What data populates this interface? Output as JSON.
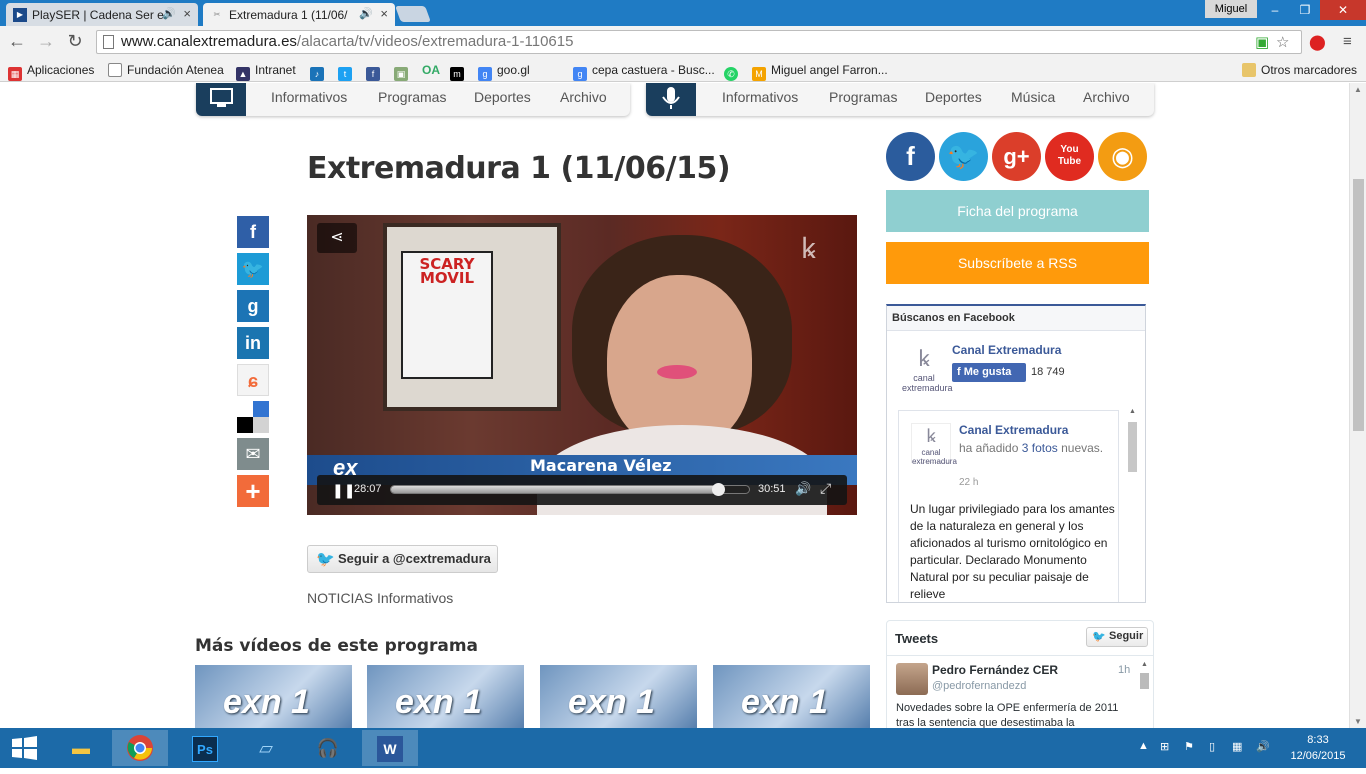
{
  "browser": {
    "tabs": [
      {
        "title": "PlaySER | Cadena Ser e",
        "favicon": "playser-icon"
      },
      {
        "title": "Extremadura 1 (11/06/",
        "favicon": "canal-extremadura-icon"
      }
    ],
    "user_name": "Miguel",
    "url_host": "www.canalextremadura.es",
    "url_path": "/alacarta/tv/videos/extremadura-1-110615",
    "bookmarks": [
      {
        "label": "Aplicaciones",
        "icon": "apps-grid-icon",
        "color": "#d33"
      },
      {
        "label": "Fundación Atenea",
        "icon": "page-icon",
        "color": "#ffffff"
      },
      {
        "label": "Intranet",
        "icon": "intranet-icon",
        "color": "#336"
      },
      {
        "label": "",
        "icon": "ser-icon",
        "color": "#1a73b8"
      },
      {
        "label": "",
        "icon": "twitter-icon",
        "color": "#1da1f2"
      },
      {
        "label": "",
        "icon": "facebook-icon",
        "color": "#3b5998"
      },
      {
        "label": "",
        "icon": "photo-icon",
        "color": "#8a7"
      },
      {
        "label": "OA",
        "icon": "oa-icon",
        "color": "#3a6"
      },
      {
        "label": "",
        "icon": "m-icon",
        "color": "#000"
      },
      {
        "label": "goo.gl",
        "icon": "google-icon",
        "color": "#4285f4"
      },
      {
        "label": "cepa castuera - Busc...",
        "icon": "google-search-icon",
        "color": "#4285f4"
      },
      {
        "label": "",
        "icon": "whatsapp-icon",
        "color": "#25d366"
      },
      {
        "label": "Miguel angel Farron...",
        "icon": "mail-icon",
        "color": "#f4a300"
      }
    ],
    "other_bookmarks": "Otros marcadores"
  },
  "tv_nav": {
    "items": [
      "Informativos",
      "Programas",
      "Deportes",
      "Archivo"
    ]
  },
  "radio_nav": {
    "items": [
      "Informativos",
      "Programas",
      "Deportes",
      "Música",
      "Archivo"
    ]
  },
  "page": {
    "title": "Extremadura 1 (11/06/15)",
    "video": {
      "current_time": "28:07",
      "duration": "30:51",
      "progress": 0.911,
      "lower_third_name": "Macarena Vélez",
      "logo_text": "ex",
      "poster_title": "SCARY MOVIL"
    },
    "follow_button": "Seguir a @cextremadura",
    "categories": "NOTICIAS Informativos",
    "more_videos_title": "Más vídeos de este programa",
    "thumb_logo": "exn 1"
  },
  "share_buttons": [
    {
      "name": "facebook-share",
      "glyph": "f",
      "color": "#2f5fa7"
    },
    {
      "name": "twitter-share",
      "glyph": "t",
      "color": "#1d9bd6"
    },
    {
      "name": "google-share",
      "glyph": "g",
      "color": "#1c74b5"
    },
    {
      "name": "linkedin-share",
      "glyph": "in",
      "color": "#1b75b0"
    },
    {
      "name": "meneame-share",
      "glyph": "m",
      "color": "#f4f4f4"
    },
    {
      "name": "delicious-share",
      "glyph": "",
      "color": "#ffffff"
    },
    {
      "name": "email-share",
      "glyph": "✉",
      "color": "#7f8c8d"
    },
    {
      "name": "more-share",
      "glyph": "+",
      "color": "#f26b3a"
    }
  ],
  "sidebar": {
    "social_icons": [
      {
        "name": "facebook",
        "glyph": "f",
        "color": "#2b5c9d"
      },
      {
        "name": "twitter",
        "glyph": "t",
        "color": "#2aa3dc"
      },
      {
        "name": "google-plus",
        "glyph": "g+",
        "color": "#db3e2a"
      },
      {
        "name": "youtube",
        "glyph": "You Tube",
        "color": "#e02b20"
      },
      {
        "name": "rss",
        "glyph": "rss",
        "color": "#f39c12"
      }
    ],
    "ficha_button": "Ficha del programa",
    "rss_button": "Subscríbete a RSS",
    "facebook_widget": {
      "header": "Búscanos en Facebook",
      "page_name": "Canal Extremadura",
      "like_label": "Me gusta",
      "like_count": "18 749",
      "logo_text": "canal extremadura",
      "post": {
        "author": "Canal Extremadura",
        "action_prefix": "ha añadido",
        "action_link": "3 fotos",
        "action_suffix": "nuevas.",
        "time": "22 h",
        "body": "Un lugar privilegiado para los amantes de la naturaleza en general y los aficionados al turismo ornitológico en particular. Declarado Monumento Natural por su peculiar paisaje de relieve"
      }
    },
    "twitter_widget": {
      "header": "Tweets",
      "follow_label": "Seguir",
      "tweet": {
        "name": "Pedro Fernández CER",
        "handle": "@pedrofernandezd",
        "time": "1h",
        "text": "Novedades sobre la OPE enfermería de 2011 tras la sentencia que desestimaba la"
      }
    }
  },
  "taskbar": {
    "apps": [
      "start",
      "explorer",
      "chrome",
      "photoshop",
      "notes",
      "audacity",
      "word"
    ],
    "time": "8:33",
    "date": "12/06/2015"
  }
}
